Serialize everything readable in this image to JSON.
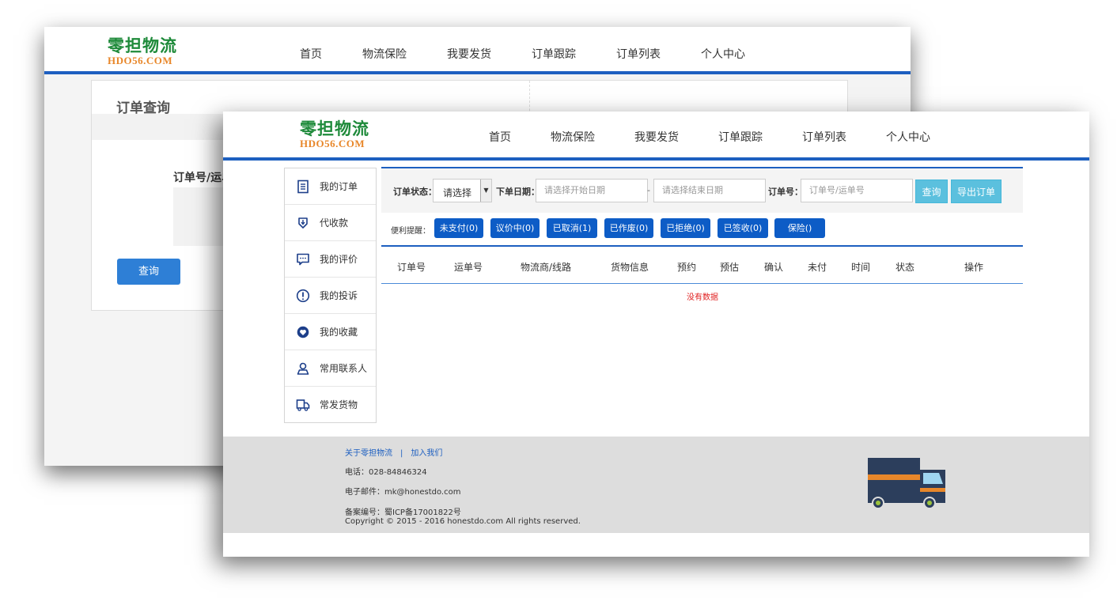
{
  "brand": {
    "name_cn": "零担物流",
    "name_en": "HDO56.COM"
  },
  "nav": [
    "首页",
    "物流保险",
    "我要发货",
    "订单跟踪",
    "订单列表",
    "个人中心"
  ],
  "back_window": {
    "panel_title": "订单查询",
    "query_label": "订单号/运单",
    "query_button": "查询"
  },
  "sidebar": {
    "items": [
      {
        "label": "我的订单",
        "icon": "list-icon"
      },
      {
        "label": "代收款",
        "icon": "download-icon"
      },
      {
        "label": "我的评价",
        "icon": "comment-icon"
      },
      {
        "label": "我的投诉",
        "icon": "alert-icon"
      },
      {
        "label": "我的收藏",
        "icon": "heart-icon"
      },
      {
        "label": "常用联系人",
        "icon": "person-icon"
      },
      {
        "label": "常发货物",
        "icon": "truck-icon"
      }
    ]
  },
  "filter": {
    "status_label": "订单状态：",
    "status_value": "请选择",
    "date_label": "下单日期：",
    "start_placeholder": "请选择开始日期",
    "date_sep": "-",
    "end_placeholder": "请选择结束日期",
    "order_label": "订单号：",
    "order_placeholder": "订单号/运单号",
    "search_button": "查询",
    "export_button": "导出订单"
  },
  "quick": {
    "label": "便利提醒：",
    "buttons": [
      "未支付(0)",
      "议价中(0)",
      "已取消(1)",
      "已作废(0)",
      "已拒绝(0)",
      "已签收(0)",
      "保险()"
    ]
  },
  "table": {
    "columns": [
      "订单号",
      "运单号",
      "物流商/线路",
      "货物信息",
      "预约",
      "预估",
      "确认",
      "未付",
      "时间",
      "状态",
      "操作"
    ],
    "empty_text": "没有数据"
  },
  "footer": {
    "link_about": "关于零担物流",
    "link_sep": "|",
    "link_join": "加入我们",
    "phone": "电话：028-84846324",
    "email": "电子邮件：mk@honestdo.com",
    "icp": "备案编号：蜀ICP备17001822号",
    "copyright": "Copyright © 2015 - 2016 honestdo.com All rights reserved."
  },
  "colors": {
    "primary": "#1d5fc0",
    "quick_button": "#0d5cc6",
    "search_button": "#5bc0de",
    "empty_text": "#e02020",
    "logo_green": "#1e8a3a",
    "logo_orange": "#e8872a"
  }
}
